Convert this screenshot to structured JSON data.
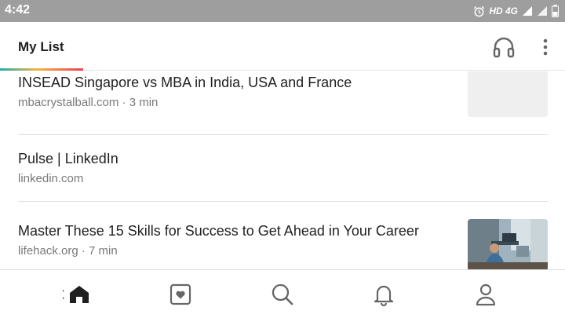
{
  "status_bar": {
    "time": "4:42",
    "network_label": "HD 4G",
    "icons": [
      "alarm-icon",
      "signal-icon",
      "signal-icon",
      "battery-icon"
    ]
  },
  "header": {
    "title": "My List",
    "actions": [
      "headphones-icon",
      "more-vert-icon"
    ]
  },
  "articles": [
    {
      "title": "INSEAD Singapore vs MBA in India, USA and France",
      "meta": "mbacrystalball.com · 3 min",
      "thumbnail": "placeholder"
    },
    {
      "title": "Pulse | LinkedIn",
      "meta": "linkedin.com",
      "thumbnail": "none"
    },
    {
      "title": "Master These 15 Skills for Success to Get Ahead in Your Career",
      "meta": "lifehack.org · 7 min",
      "thumbnail": "photo"
    }
  ],
  "bottom_nav": [
    "home-icon",
    "favorites-icon",
    "search-icon",
    "notifications-icon",
    "profile-icon"
  ],
  "colors": {
    "status_bar": "#9e9e9e",
    "text_primary": "#222222",
    "text_secondary": "#7a7a7a",
    "accent_gradient": [
      "#1cb0a8",
      "#f7b23b",
      "#ef3e56"
    ]
  }
}
